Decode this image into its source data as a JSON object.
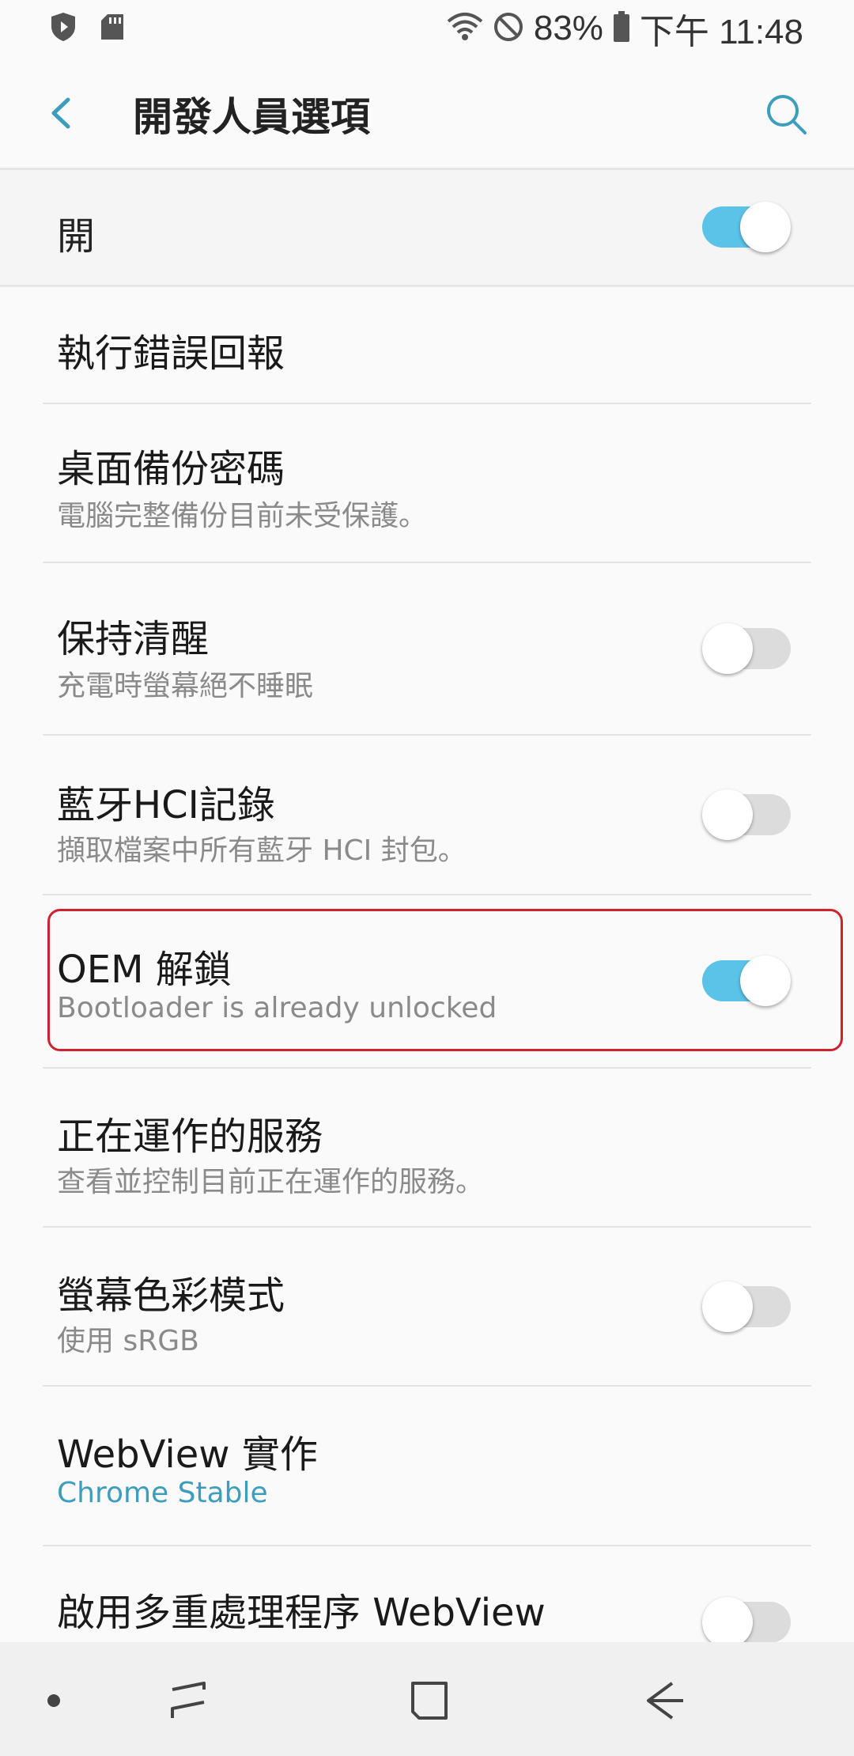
{
  "status_bar": {
    "battery": "83%",
    "time": "下午 11:48",
    "icons": [
      "shield-icon",
      "sd-card-icon",
      "wifi-icon",
      "do-not-disturb-icon",
      "battery-icon"
    ]
  },
  "app_bar": {
    "title": "開發人員選項",
    "back_icon": "chevron-left-icon",
    "search_icon": "search-icon"
  },
  "master_switch": {
    "label": "開",
    "state": "on"
  },
  "items": [
    {
      "title": "執行錯誤回報",
      "subtitle": ""
    },
    {
      "title": "桌面備份密碼",
      "subtitle": "電腦完整備份目前未受保護。"
    },
    {
      "title": "保持清醒",
      "subtitle": "充電時螢幕絕不睡眠",
      "switch": "off"
    },
    {
      "title": "藍牙HCI記錄",
      "subtitle": "擷取檔案中所有藍牙 HCI 封包。",
      "switch": "off"
    },
    {
      "title": "OEM 解鎖",
      "subtitle": "Bootloader is already unlocked",
      "switch": "on",
      "highlighted": true
    },
    {
      "title": "正在運作的服務",
      "subtitle": "查看並控制目前正在運作的服務。"
    },
    {
      "title": "螢幕色彩模式",
      "subtitle": "使用 sRGB",
      "switch": "off"
    },
    {
      "title": "WebView 實作",
      "subtitle": "Chrome Stable"
    },
    {
      "title": "啟用多重處理程序 WebView",
      "subtitle": "",
      "switch": "off"
    }
  ],
  "nav_bar": {
    "buttons": [
      "dot-button",
      "recent-apps-button",
      "home-button",
      "back-button"
    ]
  },
  "colors": {
    "accent": "#5bc3e8",
    "link": "#3d9dbd",
    "highlight_border": "#d0222e"
  }
}
